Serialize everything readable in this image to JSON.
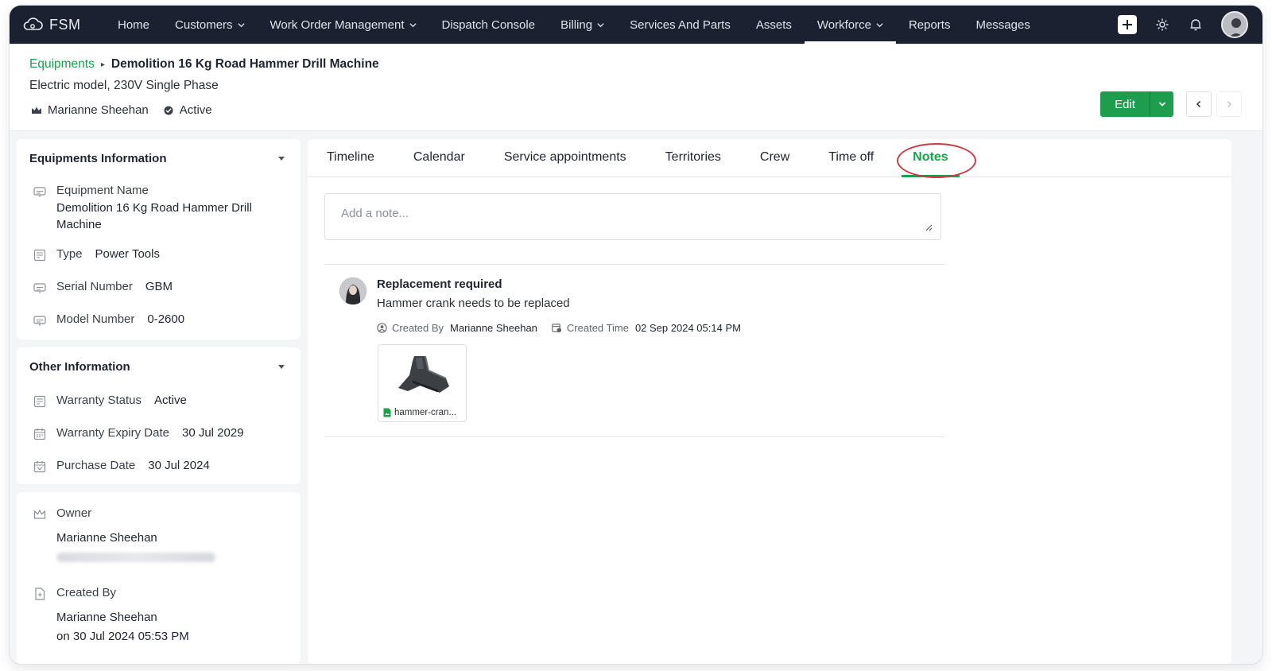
{
  "app": {
    "brand": "FSM"
  },
  "nav": {
    "items": [
      {
        "label": "Home",
        "dropdown": false,
        "active": false
      },
      {
        "label": "Customers",
        "dropdown": true,
        "active": false
      },
      {
        "label": "Work Order Management",
        "dropdown": true,
        "active": false
      },
      {
        "label": "Dispatch Console",
        "dropdown": false,
        "active": false
      },
      {
        "label": "Billing",
        "dropdown": true,
        "active": false
      },
      {
        "label": "Services And Parts",
        "dropdown": false,
        "active": false
      },
      {
        "label": "Assets",
        "dropdown": false,
        "active": false
      },
      {
        "label": "Workforce",
        "dropdown": true,
        "active": true
      },
      {
        "label": "Reports",
        "dropdown": false,
        "active": false
      },
      {
        "label": "Messages",
        "dropdown": false,
        "active": false
      }
    ],
    "right_icons": [
      "plus-icon",
      "gear-icon",
      "bell-icon",
      "user-avatar"
    ]
  },
  "header": {
    "breadcrumb_parent": "Equipments",
    "title": "Demolition 16 Kg Road Hammer Drill Machine",
    "subtitle": "Electric model, 230V Single Phase",
    "owner": "Marianne Sheehan",
    "status": "Active",
    "edit_label": "Edit"
  },
  "equipments_info": {
    "heading": "Equipments Information",
    "equipment_name_label": "Equipment Name",
    "equipment_name": "Demolition 16 Kg Road Hammer Drill Machine",
    "type_label": "Type",
    "type": "Power Tools",
    "serial_label": "Serial Number",
    "serial": "GBM",
    "model_label": "Model Number",
    "model": "0-2600"
  },
  "other_info": {
    "heading": "Other Information",
    "warranty_status_label": "Warranty Status",
    "warranty_status": "Active",
    "warranty_expiry_label": "Warranty Expiry Date",
    "warranty_expiry": "30 Jul 2029",
    "purchase_date_label": "Purchase Date",
    "purchase_date": "30 Jul 2024"
  },
  "ownership": {
    "owner_label": "Owner",
    "owner_name": "Marianne Sheehan",
    "created_by_label": "Created By",
    "created_by_name": "Marianne Sheehan",
    "created_on": "on 30 Jul 2024 05:53 PM"
  },
  "tabs": [
    {
      "label": "Timeline",
      "active": false
    },
    {
      "label": "Calendar",
      "active": false
    },
    {
      "label": "Service appointments",
      "active": false
    },
    {
      "label": "Territories",
      "active": false
    },
    {
      "label": "Crew",
      "active": false
    },
    {
      "label": "Time off",
      "active": false
    },
    {
      "label": "Notes",
      "active": true
    }
  ],
  "notes": {
    "placeholder": "Add a note...",
    "items": [
      {
        "title": "Replacement required",
        "body": "Hammer crank needs to be replaced",
        "created_by_label": "Created By",
        "created_by": "Marianne Sheehan",
        "created_time_label": "Created Time",
        "created_time": "02 Sep 2024 05:14 PM",
        "attachment_name": "hammer-cran..."
      }
    ]
  },
  "colors": {
    "accent": "#16a34a",
    "nav_bg": "#1b2130",
    "highlight_circle": "#c93c45"
  }
}
